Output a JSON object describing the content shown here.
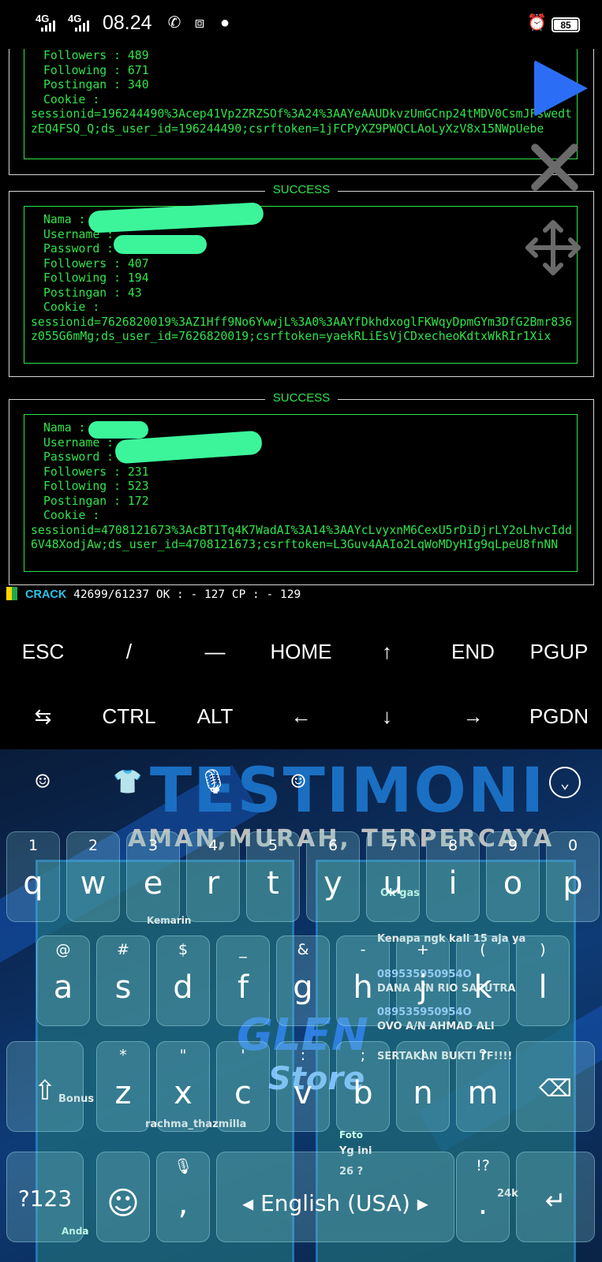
{
  "status_bar": {
    "network_1": "4G",
    "network_2": "4G",
    "time": "08.24",
    "battery": "85",
    "icons": [
      "whatsapp-icon",
      "screenshot-icon",
      "leaf-app-icon",
      "alarm-icon"
    ]
  },
  "terminal": {
    "box1": {
      "lines": [
        "Followers : 489",
        "Following : 671",
        "Postingan : 340",
        "Cookie :"
      ],
      "cookie": "sessionid=196244490%3Acep41Vp2ZRZSOf%3A24%3AAYeAAUDkvzUmGCnp24tMDV0CsmJFswedtzEQ4FSQ_Q;ds_user_id=196244490;csrftoken=1jFCPyXZ9PWQCLAoLyXzV8x15NWpUebe"
    },
    "box2": {
      "title": "SUCCESS",
      "lines": [
        "Nama : ",
        "Username : ",
        "Password : ",
        "Followers : 407",
        "Following : 194",
        "Postingan : 43",
        "Cookie :"
      ],
      "cookie": "sessionid=7626820019%3AZ1Hff9No6YwwjL%3A0%3AAYfDkhdxoglFKWqyDpmGYm3DfG2Bmr836z055G6mMg;ds_user_id=7626820019;csrftoken=yaekRLiEsVjCDxecheoKdtxWkRIr1Xix"
    },
    "box3": {
      "title": "SUCCESS",
      "lines": [
        "Nama : ",
        "Username : ",
        "Password : ",
        "Followers : 231",
        "Following : 523",
        "Postingan : 172",
        "Cookie :"
      ],
      "cookie": "sessionid=4708121673%3AcBT1Tq4K7WadAI%3A14%3AAYcLvyxnM6CexU5rDiDjrLY2oLhvcIdd6V48XodjAw;ds_user_id=4708121673;csrftoken=L3Guv4AAIo2LqWoMDyHIg9qLpeU8fnNN"
    },
    "progress_tag": "CRACK",
    "progress_text": " 42699/61237 OK : - 127 CP : - 129"
  },
  "extra_keys": {
    "row1": [
      "ESC",
      "/",
      "—",
      "HOME",
      "↑",
      "END",
      "PGUP"
    ],
    "row2": [
      "⇆",
      "CTRL",
      "ALT",
      "←",
      "↓",
      "→",
      "PGDN"
    ]
  },
  "keyboard": {
    "theme_title": "TESTIMONI",
    "theme_subtitle": "AMAN,MURAH, TERPERCAYA",
    "theme_brand_1": "GLEN",
    "theme_brand_2": "Store",
    "theme_text": [
      "Ok gas",
      "Kenapa ngk kali 15 aja ya",
      "089535950954O",
      "DANA A/N RIO SAPUTRA",
      "089535950954O",
      "OVO A/N AHMAD ALI",
      "SERTAKAN BUKTI TF!!!!",
      "Kemarin",
      "rachma_thazmilla",
      "Yg ini",
      "26 ?",
      "Bonus",
      "24k",
      "Anda",
      "Foto"
    ],
    "row_numbers": [
      "1",
      "2",
      "3",
      "4",
      "5",
      "6",
      "7",
      "8",
      "9",
      "0"
    ],
    "row_q": [
      "q",
      "w",
      "e",
      "r",
      "t",
      "y",
      "u",
      "i",
      "o",
      "p"
    ],
    "row_a": [
      {
        "hint": "@",
        "key": "a"
      },
      {
        "hint": "#",
        "key": "s"
      },
      {
        "hint": "$",
        "key": "d"
      },
      {
        "hint": "_",
        "key": "f"
      },
      {
        "hint": "&",
        "key": "g"
      },
      {
        "hint": "-",
        "key": "h"
      },
      {
        "hint": "+",
        "key": "j"
      },
      {
        "hint": "(",
        "key": "k"
      },
      {
        "hint": ")",
        "key": "l"
      }
    ],
    "row_z": [
      {
        "hint": "*",
        "key": "z"
      },
      {
        "hint": "\"",
        "key": "x"
      },
      {
        "hint": "'",
        "key": "c"
      },
      {
        "hint": ":",
        "key": "v"
      },
      {
        "hint": ";",
        "key": "b"
      },
      {
        "hint": "!",
        "key": "n"
      },
      {
        "hint": "?",
        "key": "m"
      }
    ],
    "symbols_key": "?123",
    "comma_key": ",",
    "space_label": "English (USA)",
    "period_hint": "!?",
    "period_key": "."
  }
}
